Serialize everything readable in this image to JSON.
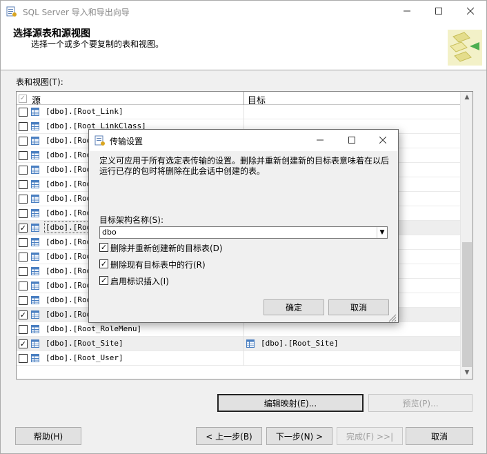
{
  "window": {
    "title": "SQL Server 导入和导出向导"
  },
  "header": {
    "title": "选择源表和源视图",
    "subtitle": "选择一个或多个要复制的表和视图。"
  },
  "grid": {
    "label": "表和视图(T):",
    "col_source": "源",
    "col_target": "目标",
    "rows": [
      {
        "source": "[dbo].[Root_Link]",
        "checked": false,
        "target": ""
      },
      {
        "source": "[dbo].[Root_LinkClass]",
        "checked": false,
        "target": ""
      },
      {
        "source": "[dbo].[Root",
        "checked": false,
        "target": ""
      },
      {
        "source": "[dbo].[Root",
        "checked": false,
        "target": ""
      },
      {
        "source": "[dbo].[Root",
        "checked": false,
        "target": ""
      },
      {
        "source": "[dbo].[Root",
        "checked": false,
        "target": ""
      },
      {
        "source": "[dbo].[Root",
        "checked": false,
        "target": ""
      },
      {
        "source": "[dbo].[Root",
        "checked": false,
        "target": ""
      },
      {
        "source": "[dbo].[Root",
        "checked": true,
        "target": ""
      },
      {
        "source": "[dbo].[Root",
        "checked": false,
        "target": ""
      },
      {
        "source": "[dbo].[Root",
        "checked": false,
        "target": ""
      },
      {
        "source": "[dbo].[Root",
        "checked": false,
        "target": ""
      },
      {
        "source": "[dbo].[Root",
        "checked": false,
        "target": ""
      },
      {
        "source": "[dbo].[Root",
        "checked": false,
        "target": ""
      },
      {
        "source": "[dbo].[Root",
        "checked": true,
        "target": ""
      },
      {
        "source": "[dbo].[Root_RoleMenu]",
        "checked": false,
        "target": ""
      },
      {
        "source": "[dbo].[Root_Site]",
        "checked": true,
        "target": "[dbo].[Root_Site]"
      },
      {
        "source": "[dbo].[Root_User]",
        "checked": false,
        "target": ""
      }
    ]
  },
  "buttons": {
    "edit_mapping": "编辑映射(E)...",
    "preview": "预览(P)...",
    "help": "帮助(H)",
    "back": "< 上一步(B)",
    "next": "下一步(N) >",
    "finish": "完成(F) >>|",
    "cancel": "取消"
  },
  "dialog": {
    "title": "传输设置",
    "description": "定义可应用于所有选定表传输的设置。删除并重新创建新的目标表意味着在以后运行已存的包时将删除在此会话中创建的表。",
    "schema_label": "目标架构名称(S):",
    "schema_value": "dbo",
    "checkboxes": [
      {
        "label": "删除并重新创建新的目标表(D)",
        "checked": true
      },
      {
        "label": "删除现有目标表中的行(R)",
        "checked": true
      },
      {
        "label": "启用标识插入(I)",
        "checked": true
      }
    ],
    "ok": "确定",
    "cancel": "取消"
  },
  "colors": {
    "window_bg": "#f0f0f0",
    "selected_row": "#eeeeee",
    "table_icon": "#4a7fc1",
    "disabled_text": "#a0a0a0"
  },
  "icons": {
    "table": "table-icon",
    "checkmark": "✓"
  }
}
